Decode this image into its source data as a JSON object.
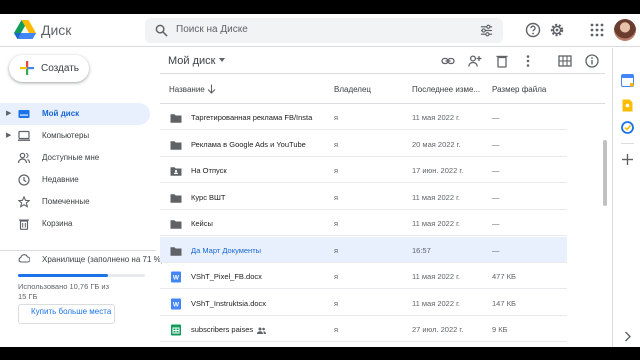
{
  "app": {
    "name": "Диск"
  },
  "search": {
    "placeholder": "Поиск на Диске"
  },
  "sidebar": {
    "create_label": "Создать",
    "items": [
      {
        "label": "Мой диск",
        "icon": "drive-icon",
        "active": true
      },
      {
        "label": "Компьютеры",
        "icon": "computer-icon"
      },
      {
        "label": "Доступные мне",
        "icon": "people-icon"
      },
      {
        "label": "Недавние",
        "icon": "clock-icon"
      },
      {
        "label": "Помеченные",
        "icon": "star-icon"
      },
      {
        "label": "Корзина",
        "icon": "trash-icon"
      }
    ],
    "storage": {
      "title": "Хранилище (заполнено на 71 %)",
      "percent": 71,
      "used_text": "Использовано 10,76 ГБ из 15 ГБ",
      "buy_label": "Купить больше места"
    }
  },
  "main": {
    "title": "Мой диск",
    "columns": {
      "name": "Название",
      "owner": "Владелец",
      "modified": "Последнее изме...",
      "size": "Размер файла"
    },
    "rows": [
      {
        "name": "Таргетированная реклама FB/Insta",
        "owner": "я",
        "date": "11 мая 2022 г.",
        "size": "—",
        "type": "folder"
      },
      {
        "name": "Реклама в Google Ads и YouTube",
        "owner": "я",
        "date": "20 мая 2022 г.",
        "size": "—",
        "type": "folder"
      },
      {
        "name": "На Отпуск",
        "owner": "я",
        "date": "17 июн. 2022 г.",
        "size": "—",
        "type": "shared-folder"
      },
      {
        "name": "Курс ВШТ",
        "owner": "я",
        "date": "11 мая 2022 г.",
        "size": "—",
        "type": "folder"
      },
      {
        "name": "Кейсы",
        "owner": "я",
        "date": "11 мая 2022 г.",
        "size": "—",
        "type": "folder"
      },
      {
        "name": "Да Март Документы",
        "owner": "я",
        "date": "16:57",
        "size": "—",
        "type": "folder",
        "selected": true
      },
      {
        "name": "VShT_Pixel_FB.docx",
        "owner": "я",
        "date": "11 мая 2022 г.",
        "size": "477 КБ",
        "type": "docx"
      },
      {
        "name": "VShT_Instruktsia.docx",
        "owner": "я",
        "date": "11 мая 2022 г.",
        "size": "147 КБ",
        "type": "docx"
      },
      {
        "name": "subscribers paises",
        "owner": "я",
        "date": "27 июл. 2022 г.",
        "size": "9 КБ",
        "type": "sheet",
        "shared": true
      }
    ]
  },
  "colors": {
    "accent": "#1a73e8",
    "selected_bg": "#e8f0fe",
    "folder": "#5f6368",
    "docx": "#4285f4",
    "sheet": "#0f9d58"
  }
}
